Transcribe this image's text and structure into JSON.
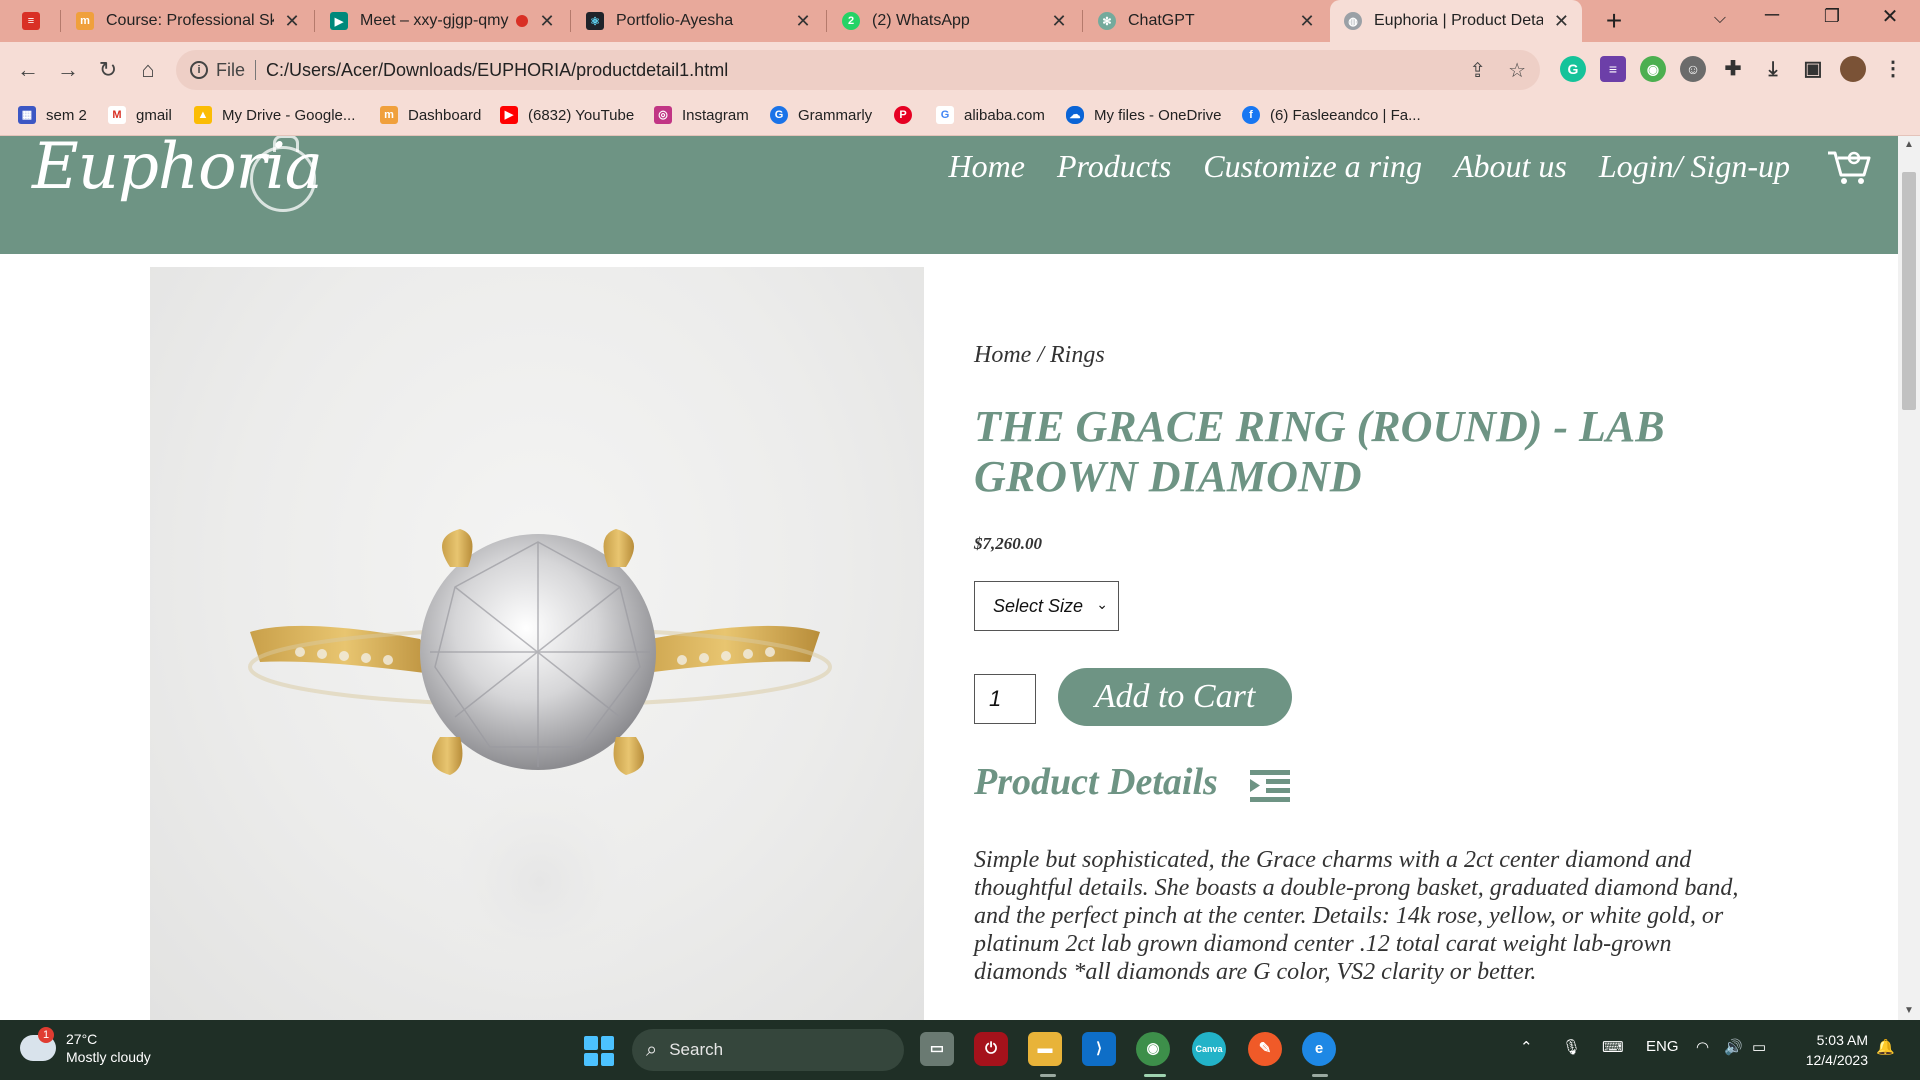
{
  "browser": {
    "tabs": [
      {
        "title": "Course: Professional Skills",
        "favicon": "moodle-icon"
      },
      {
        "title": "Meet – xxy-gjgp-qmy",
        "favicon": "meet-icon"
      },
      {
        "title": "Portfolio-Ayesha",
        "favicon": "react-icon"
      },
      {
        "title": "(2) WhatsApp",
        "favicon": "whatsapp-icon"
      },
      {
        "title": "ChatGPT",
        "favicon": "chatgpt-icon"
      },
      {
        "title": "Euphoria | Product Detail",
        "favicon": "globe-icon",
        "active": true
      }
    ],
    "address": {
      "scheme": "File",
      "url": "C:/Users/Acer/Downloads/EUPHORIA/productdetail1.html"
    },
    "bookmarks": [
      "sem 2",
      "gmail",
      "My Drive - Google...",
      "Dashboard",
      "(6832) YouTube",
      "Instagram",
      "Grammarly",
      "",
      "alibaba.com",
      "My files - OneDrive",
      "(6) Fasleeandco | Fa..."
    ]
  },
  "site": {
    "logo": "Euphoria",
    "nav": [
      "Home",
      "Products",
      "Customize a ring",
      "About us",
      "Login/ Sign-up"
    ],
    "accent": "#6e9484"
  },
  "product": {
    "breadcrumb": "Home / Rings",
    "title": "THE GRACE RING (ROUND) - LAB GROWN DIAMOND",
    "price": "$7,260.00",
    "size_select": "Select Size",
    "quantity": "1",
    "add_to_cart": "Add to Cart",
    "details_heading": "Product Details",
    "description": "Simple but sophisticated, the Grace charms with a 2ct center diamond and thoughtful details. She boasts a double-prong basket, graduated diamond band, and the perfect pinch at the center. Details: 14k rose, yellow, or white gold, or platinum 2ct lab grown diamond center .12 total carat weight lab-grown diamonds *all diamonds are G color, VS2 clarity or better."
  },
  "taskbar": {
    "weather_badge": "1",
    "temperature": "27°C",
    "weather": "Mostly cloudy",
    "search": "Search",
    "language": "ENG",
    "time": "5:03 AM",
    "date": "12/4/2023"
  }
}
